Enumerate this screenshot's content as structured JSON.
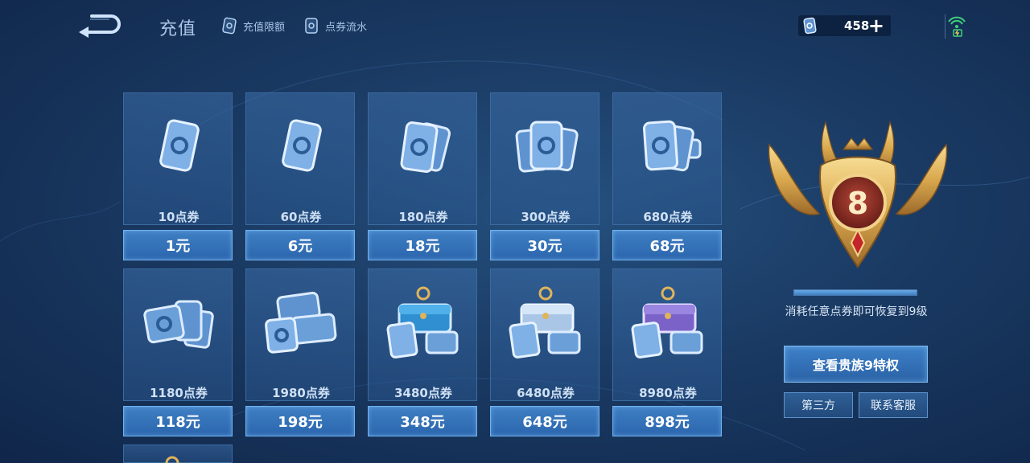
{
  "header": {
    "title": "充值",
    "links": [
      {
        "label": "充值限额",
        "icon": "voucher-card-icon"
      },
      {
        "label": "点券流水",
        "icon": "voucher-flow-icon"
      }
    ],
    "currency": {
      "icon": "voucher-coin-icon",
      "amount": "458",
      "add_label": "+"
    }
  },
  "packages": [
    {
      "amount": "10点券",
      "price": "1元",
      "art": "single-card"
    },
    {
      "amount": "60点券",
      "price": "6元",
      "art": "single-card"
    },
    {
      "amount": "180点券",
      "price": "18元",
      "art": "two-cards"
    },
    {
      "amount": "300点券",
      "price": "30元",
      "art": "three-cards"
    },
    {
      "amount": "680点券",
      "price": "68元",
      "art": "card-fan"
    },
    {
      "amount": "1180点券",
      "price": "118元",
      "art": "card-pile"
    },
    {
      "amount": "1980点券",
      "price": "198元",
      "art": "card-stack"
    },
    {
      "amount": "3480点券",
      "price": "348元",
      "art": "chest-blue"
    },
    {
      "amount": "6480点券",
      "price": "648元",
      "art": "chest-silver"
    },
    {
      "amount": "8980点券",
      "price": "898元",
      "art": "chest-purple"
    }
  ],
  "noble": {
    "level": "8",
    "progress": 1.0,
    "note": "消耗任意点券即可恢复到9级",
    "privilege_button": "查看贵族9特权"
  },
  "footer_buttons": {
    "third_party": "第三方",
    "customer_service": "联系客服"
  },
  "colors": {
    "accent": "#3f7fc4",
    "gold": "#e0b45a",
    "emblem_red": "#8f2a22"
  }
}
